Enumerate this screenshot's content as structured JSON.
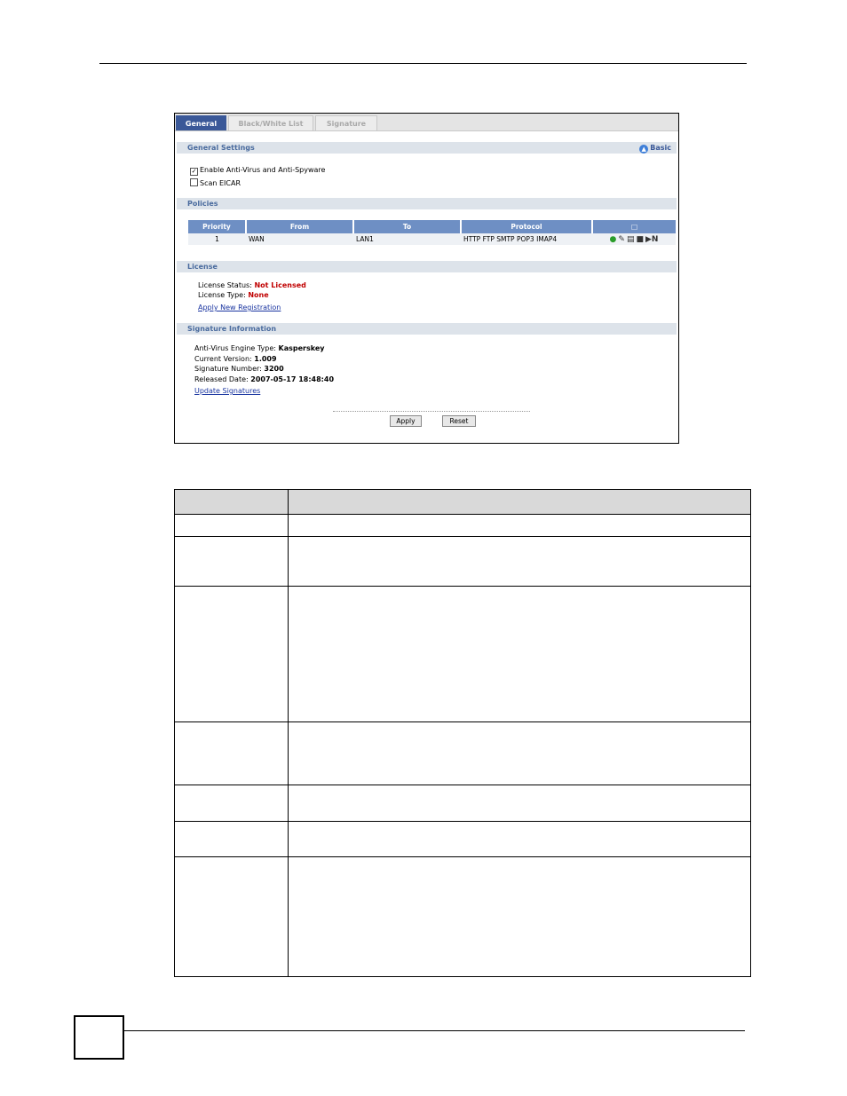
{
  "tabs": [
    "General",
    "Black/White List",
    "Signature"
  ],
  "general_settings": {
    "title": "General Settings",
    "basic_link": "Basic",
    "enable_av_label": "Enable Anti-Virus and Anti-Spyware",
    "enable_av_checked": true,
    "scan_eicar_label": "Scan EICAR",
    "scan_eicar_checked": false
  },
  "policies": {
    "title": "Policies",
    "columns": [
      "Priority",
      "From",
      "To",
      "Protocol"
    ],
    "rows": [
      {
        "priority": "1",
        "from": "WAN",
        "to": "LAN1",
        "protocol": "HTTP FTP SMTP POP3 IMAP4"
      }
    ]
  },
  "license": {
    "title": "License",
    "status_label": "License Status:",
    "status_value": "Not Licensed",
    "type_label": "License Type:",
    "type_value": "None",
    "apply_link": "Apply New Registration"
  },
  "signature_info": {
    "title": "Signature Information",
    "engine_label": "Anti-Virus Engine Type:",
    "engine_value": "Kasperskey",
    "version_label": "Current Version:",
    "version_value": "1.009",
    "number_label": "Signature Number:",
    "number_value": "3200",
    "released_label": "Released Date:",
    "released_value": "2007-05-17 18:48:40",
    "update_link": "Update Signatures"
  },
  "buttons": {
    "apply": "Apply",
    "reset": "Reset"
  }
}
